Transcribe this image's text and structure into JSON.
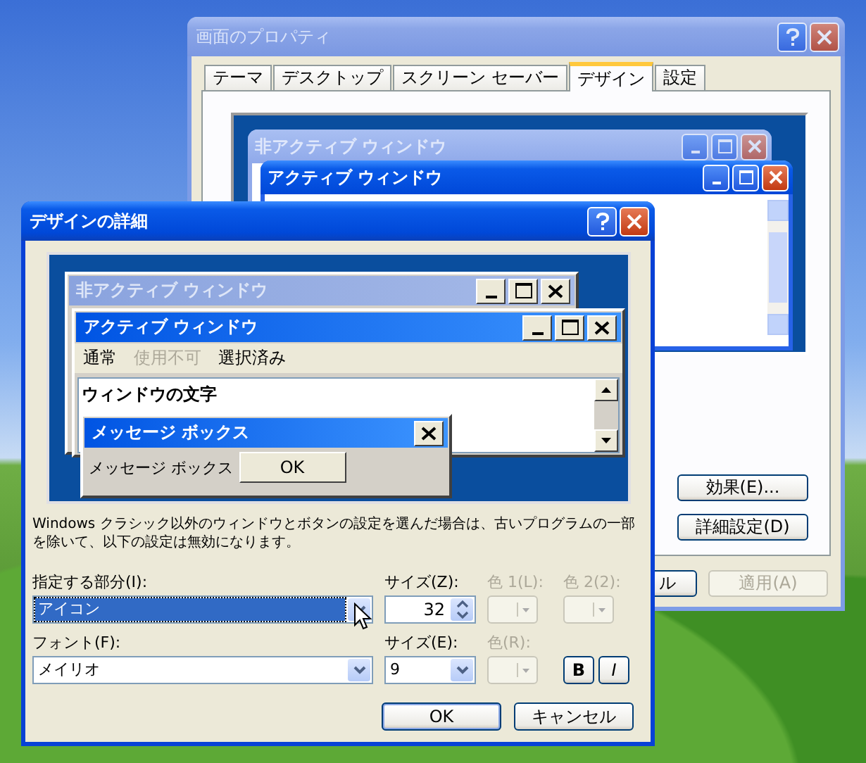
{
  "display_properties": {
    "title": "画面のプロパティ",
    "tabs": [
      {
        "label": "テーマ",
        "selected": false
      },
      {
        "label": "デスクトップ",
        "selected": false
      },
      {
        "label": "スクリーン セーバー",
        "selected": false
      },
      {
        "label": "デザイン",
        "selected": true
      },
      {
        "label": "設定",
        "selected": false
      }
    ],
    "preview": {
      "inactive_title": "非アクティブ ウィンドウ",
      "active_title": "アクティブ ウィンドウ"
    },
    "buttons": [
      {
        "label": "効果(E)...",
        "disabled": false
      },
      {
        "label": "詳細設定(D)",
        "disabled": false
      }
    ],
    "footer_buttons": [
      {
        "label": "ル",
        "disabled": false
      },
      {
        "label": "適用(A)",
        "disabled": true
      }
    ]
  },
  "advanced_dialog": {
    "title": "デザインの詳細",
    "preview": {
      "inactive_title": "非アクティブ ウィンドウ",
      "active_title": "アクティブ ウィンドウ",
      "menu": [
        {
          "label": "通常",
          "disabled": false
        },
        {
          "label": "使用不可",
          "disabled": true
        },
        {
          "label": "選択済み",
          "disabled": false
        }
      ],
      "window_text": "ウィンドウの文字",
      "message_box": {
        "title": "メッセージ ボックス",
        "text": "メッセージ ボックス",
        "button": "OK"
      }
    },
    "description": "Windows クラシック以外のウィンドウとボタンの設定を選んだ場合は、古いプログラムの一部を除いて、以下の設定は無効になります。",
    "fields": [
      {
        "kind": "dropdown",
        "label": "指定する部分(I):",
        "value": "アイコン",
        "focused": true
      },
      {
        "kind": "spinner",
        "label": "サイズ(Z):",
        "value": "32"
      },
      {
        "kind": "color",
        "label": "色 1(L):",
        "disabled": true
      },
      {
        "kind": "color",
        "label": "色 2(2):",
        "disabled": true
      },
      {
        "kind": "dropdown",
        "label": "フォント(F):",
        "value": "メイリオ",
        "focused": false
      },
      {
        "kind": "dropdown",
        "label": "サイズ(E):",
        "value": "9",
        "focused": false
      },
      {
        "kind": "color",
        "label": "色(R):",
        "disabled": true
      },
      {
        "kind": "toggles",
        "toggles": [
          {
            "label": "B"
          },
          {
            "label": "I"
          }
        ]
      }
    ],
    "buttons": [
      "OK",
      "キャンセル"
    ]
  }
}
